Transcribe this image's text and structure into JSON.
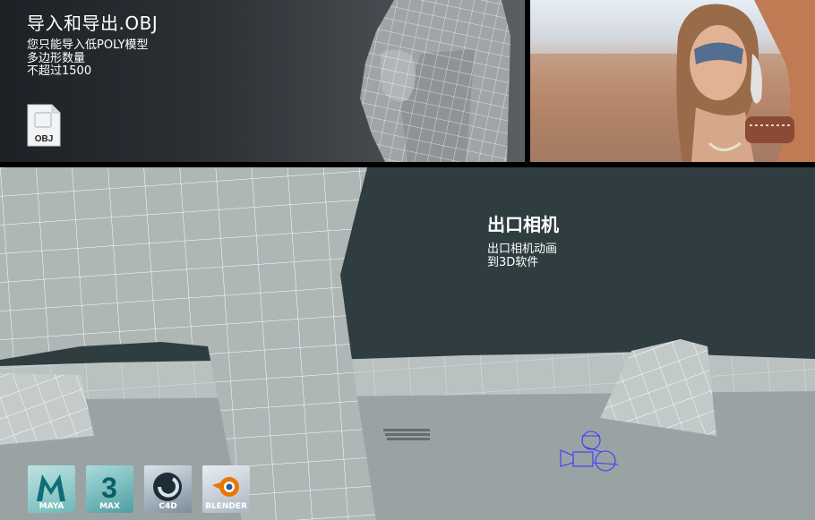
{
  "obj_panel": {
    "title": "导入和导出.OBJ",
    "lines": [
      "您只能导入低POLY模型",
      "多边形数量",
      "不超过1500"
    ],
    "file_icon_label": "OBJ"
  },
  "camera_panel": {
    "title": "出口相机",
    "lines": [
      "出口相机动画",
      "到3D软件"
    ]
  },
  "apps": [
    {
      "name": "maya",
      "label": "MAYA"
    },
    {
      "name": "3ds-max",
      "label": "MAX"
    },
    {
      "name": "cinema4d",
      "label": "C4D"
    },
    {
      "name": "blender",
      "label": "BLENDER"
    }
  ]
}
